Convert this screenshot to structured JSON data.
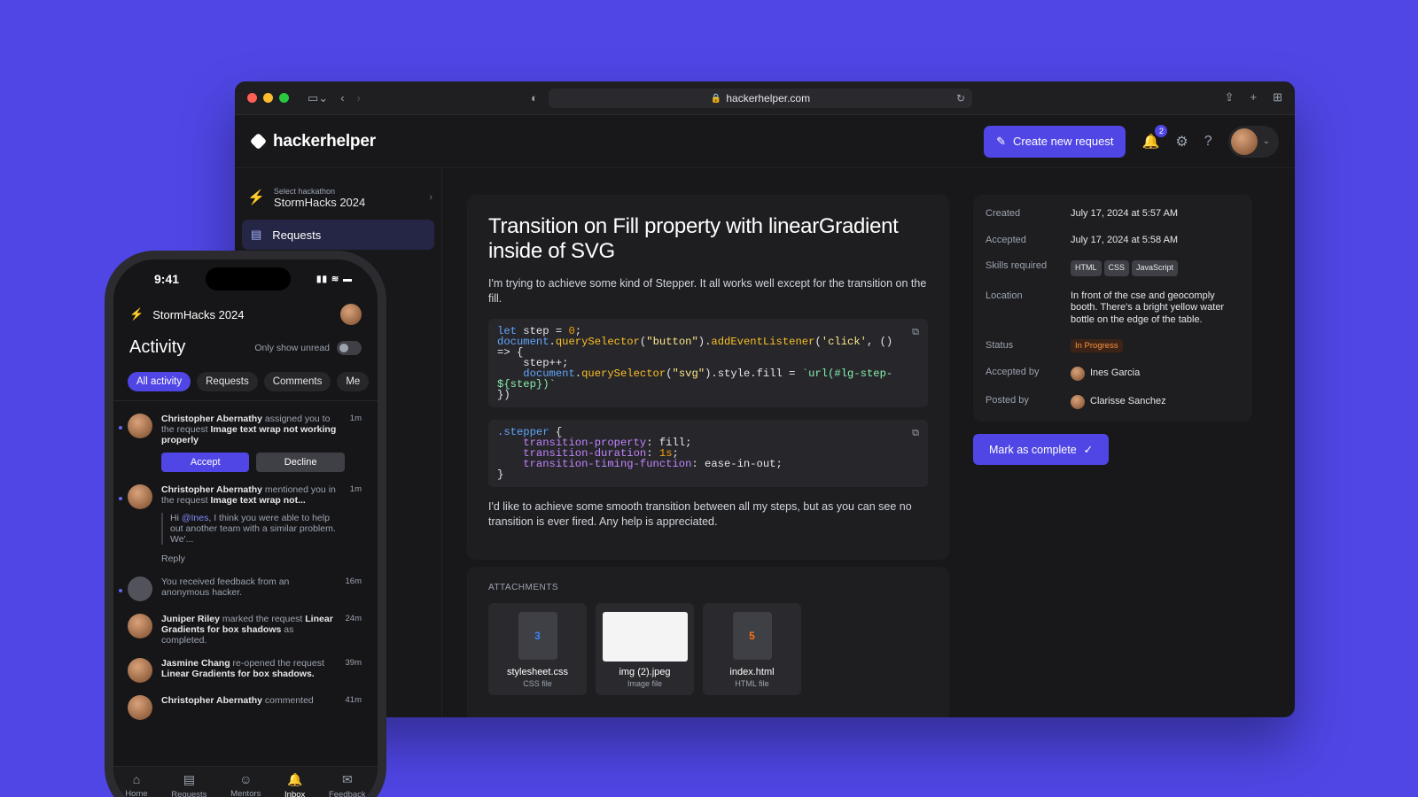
{
  "browser": {
    "url": "hackerhelper.com"
  },
  "app": {
    "logo": "hackerhelper",
    "create_button": "Create new request",
    "notification_count": "2",
    "sidebar": {
      "select_label": "Select hackathon",
      "hackathon": "StormHacks 2024",
      "items": [
        {
          "label": "Requests",
          "icon": "requests-icon"
        }
      ]
    },
    "request": {
      "title": "Transition on Fill property with linearGradient inside of SVG",
      "intro": "I'm trying to achieve some kind of Stepper. It all works well except for the transition on the fill.",
      "outro": "I'd like to achieve some smooth transition between all my steps, but as you can see no transition is ever fired. Any help is appreciated.",
      "attachments_label": "ATTACHMENTS",
      "attachments": [
        {
          "name": "stylesheet.css",
          "type": "CSS file",
          "icon": "css-icon"
        },
        {
          "name": "img (2).jpeg",
          "type": "Image file",
          "icon": "image-thumbnail"
        },
        {
          "name": "index.html",
          "type": "HTML file",
          "icon": "html-icon"
        }
      ]
    },
    "details": {
      "created_label": "Created",
      "created": "July 17, 2024 at 5:57 AM",
      "accepted_label": "Accepted",
      "accepted": "July 17, 2024 at 5:58 AM",
      "skills_label": "Skills required",
      "skills": [
        "HTML",
        "CSS",
        "JavaScript"
      ],
      "location_label": "Location",
      "location": "In front of the cse and geocomply booth. There's a bright yellow water bottle on the edge of the table.",
      "status_label": "Status",
      "status": "In Progress",
      "accepted_by_label": "Accepted by",
      "accepted_by": "Ines Garcia",
      "posted_by_label": "Posted by",
      "posted_by": "Clarisse Sanchez"
    },
    "mark_complete": "Mark as complete"
  },
  "phone": {
    "time": "9:41",
    "hackathon": "StormHacks 2024",
    "title": "Activity",
    "unread_toggle": "Only show unread",
    "filters": [
      "All activity",
      "Requests",
      "Comments",
      "Me"
    ],
    "feed": [
      {
        "who": "Christopher Abernathy",
        "text": "assigned you to the request",
        "target": "Image text wrap not working properly",
        "time": "1m",
        "accept": "Accept",
        "decline": "Decline"
      },
      {
        "who": "Christopher Abernathy",
        "text": "mentioned you in the request",
        "target": "Image text wrap not...",
        "time": "1m",
        "quote_pre": "Hi",
        "mention": "@Ines",
        "quote_post": ", I think you were able to help out another team with a similar problem. We'...",
        "reply": "Reply"
      },
      {
        "text": "You received feedback from an anonymous hacker.",
        "time": "16m"
      },
      {
        "who": "Juniper Riley",
        "text": "marked the request",
        "target": "Linear Gradients for box shadows",
        "text2": "as completed.",
        "time": "24m"
      },
      {
        "who": "Jasmine Chang",
        "text": "re-opened the request",
        "target": "Linear Gradients for box shadows.",
        "time": "39m"
      },
      {
        "who": "Christopher Abernathy",
        "text": "commented",
        "time": "41m"
      }
    ],
    "tabs": [
      "Home",
      "Requests",
      "Mentors",
      "Inbox",
      "Feedback"
    ]
  },
  "colors": {
    "accent": "#4f46e5",
    "status_orange": "#fb923c"
  }
}
